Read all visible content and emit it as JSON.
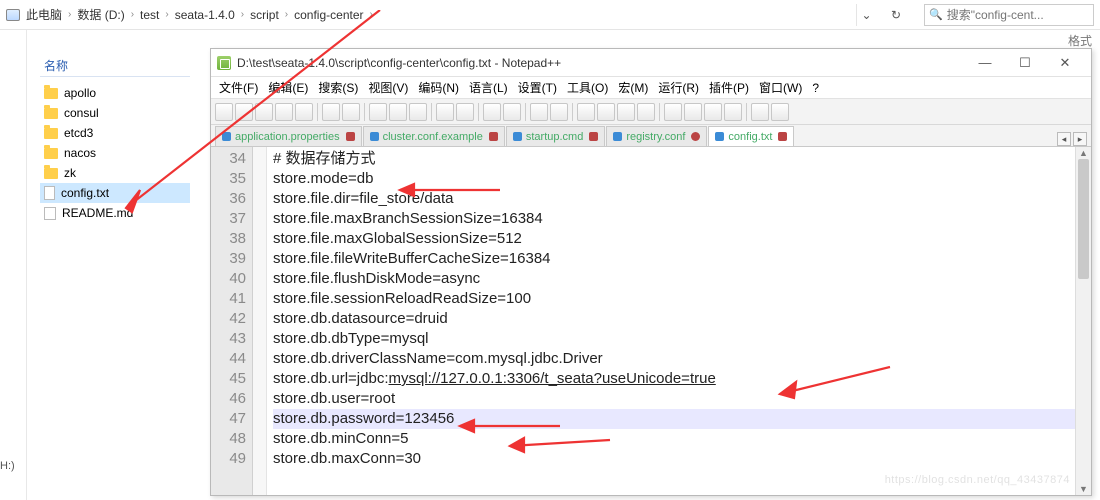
{
  "breadcrumb": {
    "segs": [
      "此电脑",
      "数据 (D:)",
      "test",
      "seata-1.4.0",
      "script",
      "config-center"
    ],
    "search_placeholder": "搜索\"config-cent..."
  },
  "rightlabel": "格式",
  "drive_label": "H:)",
  "explorer": {
    "header": "名称",
    "items": [
      {
        "type": "folder",
        "label": "apollo"
      },
      {
        "type": "folder",
        "label": "consul"
      },
      {
        "type": "folder",
        "label": "etcd3"
      },
      {
        "type": "folder",
        "label": "nacos"
      },
      {
        "type": "folder",
        "label": "zk"
      },
      {
        "type": "file",
        "label": "config.txt",
        "selected": true
      },
      {
        "type": "md",
        "label": "README.md"
      }
    ]
  },
  "npp": {
    "title": "D:\\test\\seata-1.4.0\\script\\config-center\\config.txt - Notepad++",
    "menu": [
      "文件(F)",
      "编辑(E)",
      "搜索(S)",
      "视图(V)",
      "编码(N)",
      "语言(L)",
      "设置(T)",
      "工具(O)",
      "宏(M)",
      "运行(R)",
      "插件(P)",
      "窗口(W)",
      "?"
    ],
    "tabs": [
      {
        "label": "application.properties",
        "dirty": true
      },
      {
        "label": "cluster.conf.example",
        "dirty": true
      },
      {
        "label": "startup.cmd",
        "dirty": true
      },
      {
        "label": "registry.conf",
        "dirty": false
      },
      {
        "label": "config.txt",
        "dirty": true,
        "active": true
      }
    ],
    "first_lineno": 34,
    "lines": [
      "# 数据存储方式",
      "store.mode=db",
      "store.file.dir=file_store/data",
      "store.file.maxBranchSessionSize=16384",
      "store.file.maxGlobalSessionSize=512",
      "store.file.fileWriteBufferCacheSize=16384",
      "store.file.flushDiskMode=async",
      "store.file.sessionReloadReadSize=100",
      "store.db.datasource=druid",
      "store.db.dbType=mysql",
      "store.db.driverClassName=com.mysql.jdbc.Driver",
      "store.db.url=jdbc:mysql://127.0.0.1:3306/t_seata?useUnicode=true",
      "store.db.user=root",
      "store.db.password=123456",
      "store.db.minConn=5",
      "store.db.maxConn=30"
    ],
    "url_prefix": "store.db.url=jdbc:",
    "url_underlined": "mysql://127.0.0.1:3306/t_seata?useUnicode=true",
    "highlight_index": 13
  },
  "watermark": "https://blog.csdn.net/qq_43437874"
}
